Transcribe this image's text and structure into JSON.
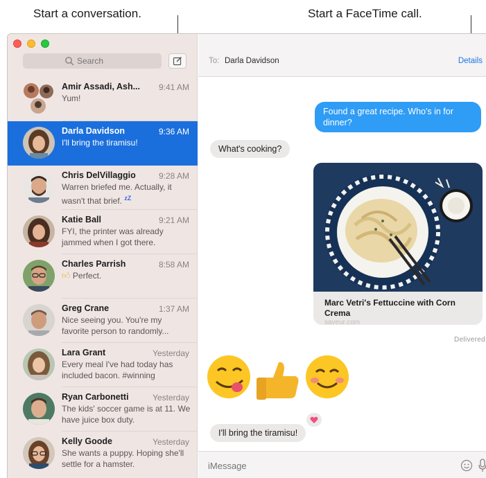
{
  "callouts": {
    "compose": "Start a conversation.",
    "facetime": "Start a FaceTime call."
  },
  "search": {
    "placeholder": "Search"
  },
  "conversations": [
    {
      "name": "Amir Assadi, Ash...",
      "time": "9:41 AM",
      "preview": "Yum!"
    },
    {
      "name": "Darla Davidson",
      "time": "9:36 AM",
      "preview": "I'll bring the tiramisu!"
    },
    {
      "name": "Chris DelVillaggio",
      "time": "9:28 AM",
      "preview": "Warren briefed me. Actually, it wasn't that brief.",
      "preview_suffix": "zZ"
    },
    {
      "name": "Katie Ball",
      "time": "9:21 AM",
      "preview": "FYI, the printer was already jammed when I got there."
    },
    {
      "name": "Charles Parrish",
      "time": "8:58 AM",
      "preview": "Perfect."
    },
    {
      "name": "Greg Crane",
      "time": "1:37 AM",
      "preview": "Nice seeing you. You're my favorite person to randomly..."
    },
    {
      "name": "Lara Grant",
      "time": "Yesterday",
      "preview": "Every meal I've had today has included bacon. #winning"
    },
    {
      "name": "Ryan Carbonetti",
      "time": "Yesterday",
      "preview": "The kids' soccer game is at 11. We have juice box duty."
    },
    {
      "name": "Kelly Goode",
      "time": "Yesterday",
      "preview": "She wants a puppy. Hoping she'll settle for a hamster."
    }
  ],
  "header": {
    "to_label": "To:",
    "recipient": "Darla Davidson",
    "details": "Details"
  },
  "messages": {
    "outgoing": "Found a great recipe. Who's in for dinner?",
    "reply": "What's cooking?",
    "card_title": "Marc Vetri's Fettuccine with Corn Crema",
    "card_domain": "saveur.com",
    "status": "Delivered",
    "last": "I'll bring the tiramisu!"
  },
  "input": {
    "placeholder": "iMessage"
  },
  "colors": {
    "accent": "#1a6fdd",
    "bubble_blue": "#2f9cf5",
    "link": "#1a74e8"
  }
}
